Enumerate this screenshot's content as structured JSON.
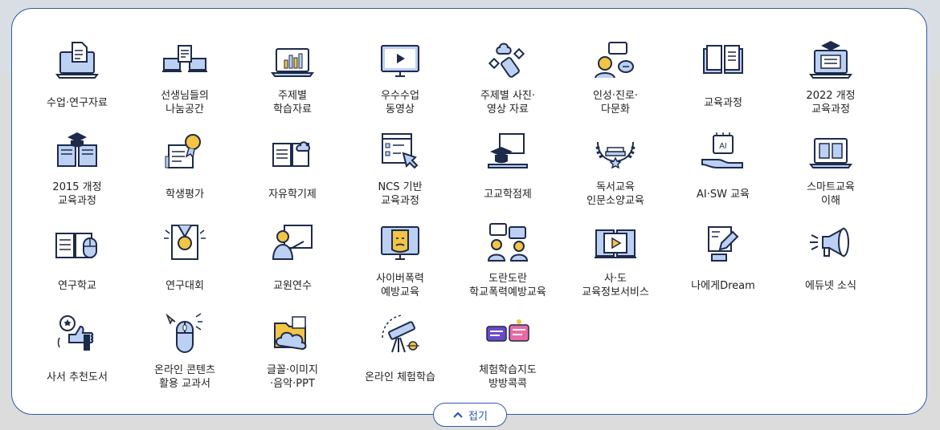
{
  "menu": {
    "items": [
      {
        "label": "수업·연구자료",
        "icon": "document-laptop-icon"
      },
      {
        "label": "선생님들의\n나눔공간",
        "icon": "laptops-sharing-icon"
      },
      {
        "label": "주제별\n학습자료",
        "icon": "laptop-chart-icon"
      },
      {
        "label": "우수수업\n동영상",
        "icon": "video-monitor-icon"
      },
      {
        "label": "주제별 사진·\n영상 자료",
        "icon": "usb-cloud-icon"
      },
      {
        "label": "인성·진로·\n다문화",
        "icon": "person-chat-icon"
      },
      {
        "label": "교육과정",
        "icon": "open-book-icon"
      },
      {
        "label": "2022 개정\n교육과정",
        "icon": "graduation-laptop-icon"
      },
      {
        "label": "2015 개정\n교육과정",
        "icon": "graduation-book-icon"
      },
      {
        "label": "학생평가",
        "icon": "award-badge-icon"
      },
      {
        "label": "자유학기제",
        "icon": "book-cloud-icon"
      },
      {
        "label": "NCS 기반\n교육과정",
        "icon": "checklist-touch-icon"
      },
      {
        "label": "고교학점제",
        "icon": "graduation-board-icon"
      },
      {
        "label": "독서교육\n인문소양교육",
        "icon": "laurel-books-icon"
      },
      {
        "label": "AI·SW 교육",
        "icon": "ai-chip-hand-icon"
      },
      {
        "label": "스마트교육\n이해",
        "icon": "ebook-laptop-icon"
      },
      {
        "label": "연구학교",
        "icon": "book-mouse-icon"
      },
      {
        "label": "연구대회",
        "icon": "medal-icon"
      },
      {
        "label": "교원연수",
        "icon": "teacher-board-icon"
      },
      {
        "label": "사이버폭력\n예방교육",
        "icon": "sad-monitor-icon"
      },
      {
        "label": "도란도란\n학교폭력예방교육",
        "icon": "people-talking-icon"
      },
      {
        "label": "사·도\n교육정보서비스",
        "icon": "play-book-icon"
      },
      {
        "label": "나에게Dream",
        "icon": "gift-hand-icon"
      },
      {
        "label": "에듀넷 소식",
        "icon": "megaphone-icon"
      },
      {
        "label": "사서 추천도서",
        "icon": "thumbs-up-star-icon"
      },
      {
        "label": "온라인 콘텐츠\n활용 교과서",
        "icon": "computer-mouse-icon"
      },
      {
        "label": "글꼴·이미지\n·음악·PPT",
        "icon": "folder-cloud-icon"
      },
      {
        "label": "온라인 체험학습",
        "icon": "telescope-icon"
      },
      {
        "label": "체험학습지도\n방방콕콕",
        "icon": "bangbang-logo-icon"
      }
    ]
  },
  "fold_button": {
    "label": "접기",
    "icon": "chevron-up-icon"
  },
  "colors": {
    "accent": "#2f5aa8",
    "icon_fill": "#bcd0f3",
    "icon_stroke": "#1d2a4a",
    "highlight": "#f4c542"
  }
}
